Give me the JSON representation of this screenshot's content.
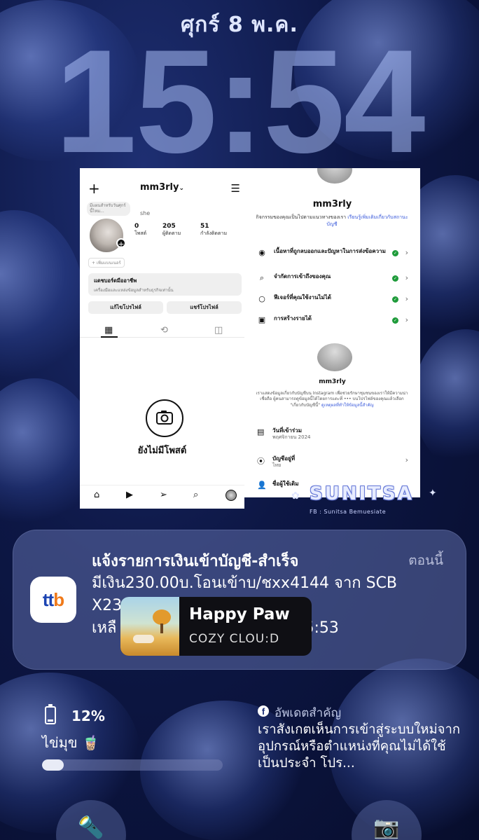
{
  "lockscreen": {
    "date": "ศุกร์ 8 พ.ค.",
    "time": "15:54"
  },
  "instagram_profile": {
    "username": "mm3rly",
    "username_chevron": "⌄",
    "note_bubble": "มีแผนสำหรับวันศุกร์นี้ไหม...",
    "bio_name": "she",
    "stats": [
      {
        "value": "0",
        "label": "โพสต์"
      },
      {
        "value": "205",
        "label": "ผู้ติดตาม"
      },
      {
        "value": "51",
        "label": "กำลังติดตาม"
      }
    ],
    "pronoun_label": "+ เพิ่มแบนเนอร์",
    "dashboard_title": "แดชบอร์ดมืออาชีพ",
    "dashboard_sub": "เครื่องมือและแหล่งข้อมูลสำหรับธุรกิจเท่านั้น",
    "edit_profile": "แก้ไขโปรไฟล์",
    "share_profile": "แชร์โปรไฟล์",
    "no_posts": "ยังไม่มีโพสต์"
  },
  "account_status": {
    "username": "mm3rly",
    "description": "กิจกรรมของคุณเป็นไปตามแนวทางของเรา",
    "description_link": "เรียนรู้เพิ่มเติมเกี่ยวกับสถานะบัญชี",
    "rows": [
      {
        "label": "เนื้อหาที่ถูกลบออกและปัญหาในการส่งข้อความ"
      },
      {
        "label": "จำกัดการเข้าถึงของคุณ"
      },
      {
        "label": "ฟีเจอร์ที่คุณใช้งานไม่ได้"
      },
      {
        "label": "การสร้างรายได้"
      }
    ],
    "about_username": "mm3rly",
    "about_text": "เราแสดงข้อมูลเกี่ยวกับบัญชีบน Instagram เพื่อช่วยรักษาชุมชนของเราให้มีความน่าเชื่อถือ ผู้คนสามารถดูข้อมูลนี้ได้โดยการแตะที่ ••• บนโปรไฟล์ของคุณแล้วเลือก \"เกี่ยวกับบัญชีนี้\"",
    "about_link": "ดูเหตุผลที่ทำให้ข้อมูลนี้สำคัญ",
    "joined_title": "วันที่เข้าร่วม",
    "joined_value": "พฤศจิกายน 2024",
    "country_title": "บัญชีอยู่ที่",
    "country_value": "ไทย",
    "former_title": "ชื่อผู้ใช้เดิม"
  },
  "sticker": {
    "text": "SUNITSA",
    "sub": "FB : Sunitsa Bemuesiate"
  },
  "notification": {
    "title": "แจ้งรายการเงินเข้าบัญชี-สำเร็จ",
    "time": "ตอนนี้",
    "body_line1": "มีเงิน230.00บ.โอนเข้าบ/ชxx4144 จาก SCB",
    "body_line2": "X23",
    "body_line3_start": "เหลื",
    "body_line3_end": "5:53",
    "app_logo": "ttb"
  },
  "music_popup": {
    "title": "Happy Paw",
    "artist": "COZY CLOU:D"
  },
  "battery_widget": {
    "percent": "12%",
    "device_name": "ไข่มุข 🧋",
    "level": 0.12
  },
  "facebook_widget": {
    "title": "อัพเดตสำคัญ",
    "body": "เราสังเกตเห็นการเข้าสู่ระบบใหม่จากอุปกรณ์หรือตำแหน่งที่คุณไม่ได้ใช้เป็นประจำ โปร..."
  },
  "colors": {
    "accent": "#3b5bdb",
    "ok_green": "#1e9b3a",
    "ttb_blue": "#1c44b2",
    "ttb_orange": "#f07a1a"
  },
  "icons": {
    "flashlight": "flashlight-icon",
    "camera": "camera-icon"
  }
}
